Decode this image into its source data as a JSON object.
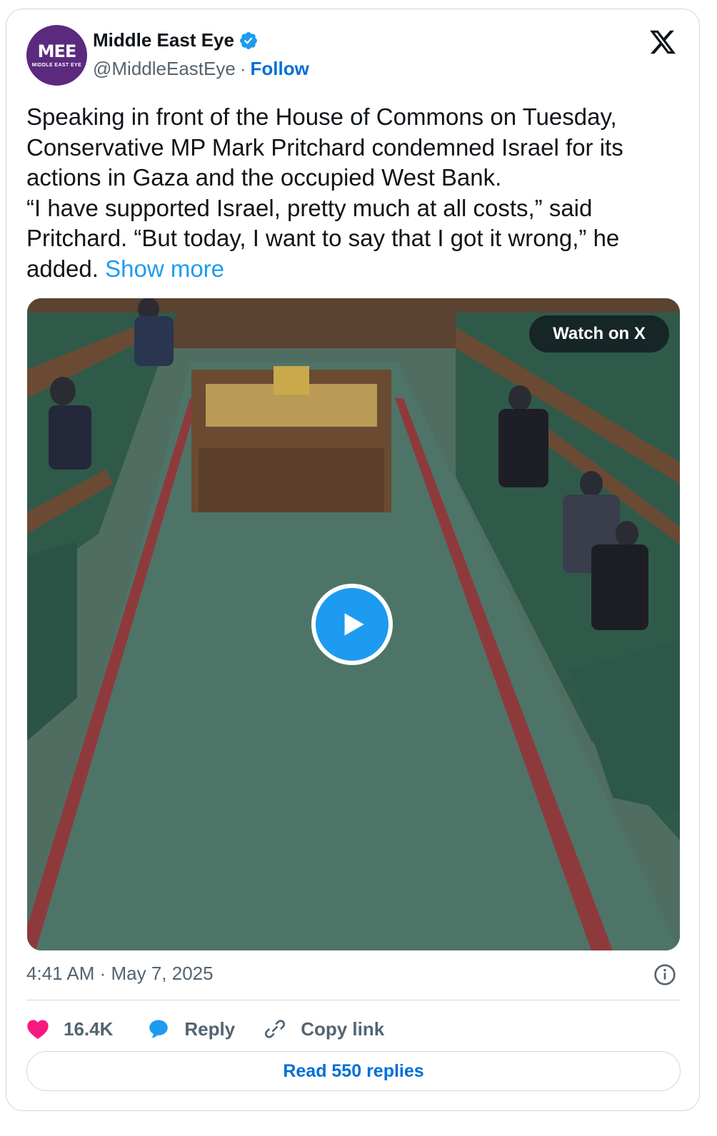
{
  "tweet": {
    "author": {
      "avatar_text": "MEE",
      "avatar_subtext": "MIDDLE EAST EYE",
      "name": "Middle East Eye",
      "handle": "@MiddleEastEye",
      "separator": "·",
      "follow_label": "Follow",
      "verified": true
    },
    "text": "Speaking in front of the House of Commons on Tuesday, Conservative MP Mark Pritchard condemned Israel for its actions in Gaza and the occupied West Bank.\n“I have supported Israel, pretty much at all costs,” said Pritchard. “But today, I want to say that I got it wrong,” he added. ",
    "show_more_label": "Show more",
    "media": {
      "watch_label": "Watch on X",
      "type": "video"
    },
    "timestamp": "4:41 AM · May 7, 2025",
    "actions": {
      "likes": "16.4K",
      "reply_label": "Reply",
      "copy_link_label": "Copy link"
    },
    "read_replies_label": "Read 550 replies"
  },
  "colors": {
    "accent": "#1d9bf0",
    "link": "#006fd6",
    "like": "#f91880",
    "avatar_bg": "#5b2a7e"
  }
}
